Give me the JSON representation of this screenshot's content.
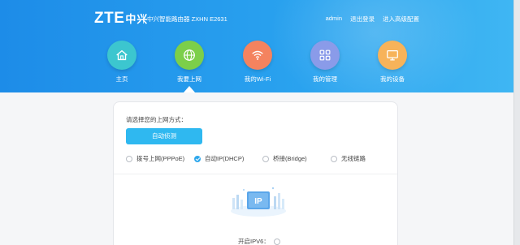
{
  "header": {
    "logo_text": "ZTE",
    "logo_cn": "中兴",
    "product_name": "中兴智能路由器 ZXHN E2631",
    "links": {
      "user": "admin",
      "logout": "退出登录",
      "advanced": "进入高级配置"
    }
  },
  "nav": {
    "items": [
      {
        "label": "主页",
        "color": "#3cc6cf",
        "icon": "home-icon"
      },
      {
        "label": "我要上网",
        "color": "#7ccf4a",
        "icon": "globe-icon"
      },
      {
        "label": "我的Wi-Fi",
        "color": "#f4835f",
        "icon": "wifi-icon"
      },
      {
        "label": "我的管理",
        "color": "#8a9be9",
        "icon": "grid-icon"
      },
      {
        "label": "我的设备",
        "color": "#f7b35a",
        "icon": "monitor-icon"
      }
    ],
    "active_index": 1
  },
  "main": {
    "prompt": "请选择您的上网方式：",
    "detect_button": "自动侦测",
    "modes": [
      {
        "label": "拨号上网(PPPoE)",
        "checked": false
      },
      {
        "label": "自动IP(DHCP)",
        "checked": true
      },
      {
        "label": "桥接(Bridge)",
        "checked": false
      },
      {
        "label": "无线链路",
        "checked": false
      }
    ],
    "illustration_text": "IP",
    "ipv6_label": "开启IPV6："
  },
  "colors": {
    "accent": "#2fb8f0",
    "header": "#1d8ce8"
  }
}
